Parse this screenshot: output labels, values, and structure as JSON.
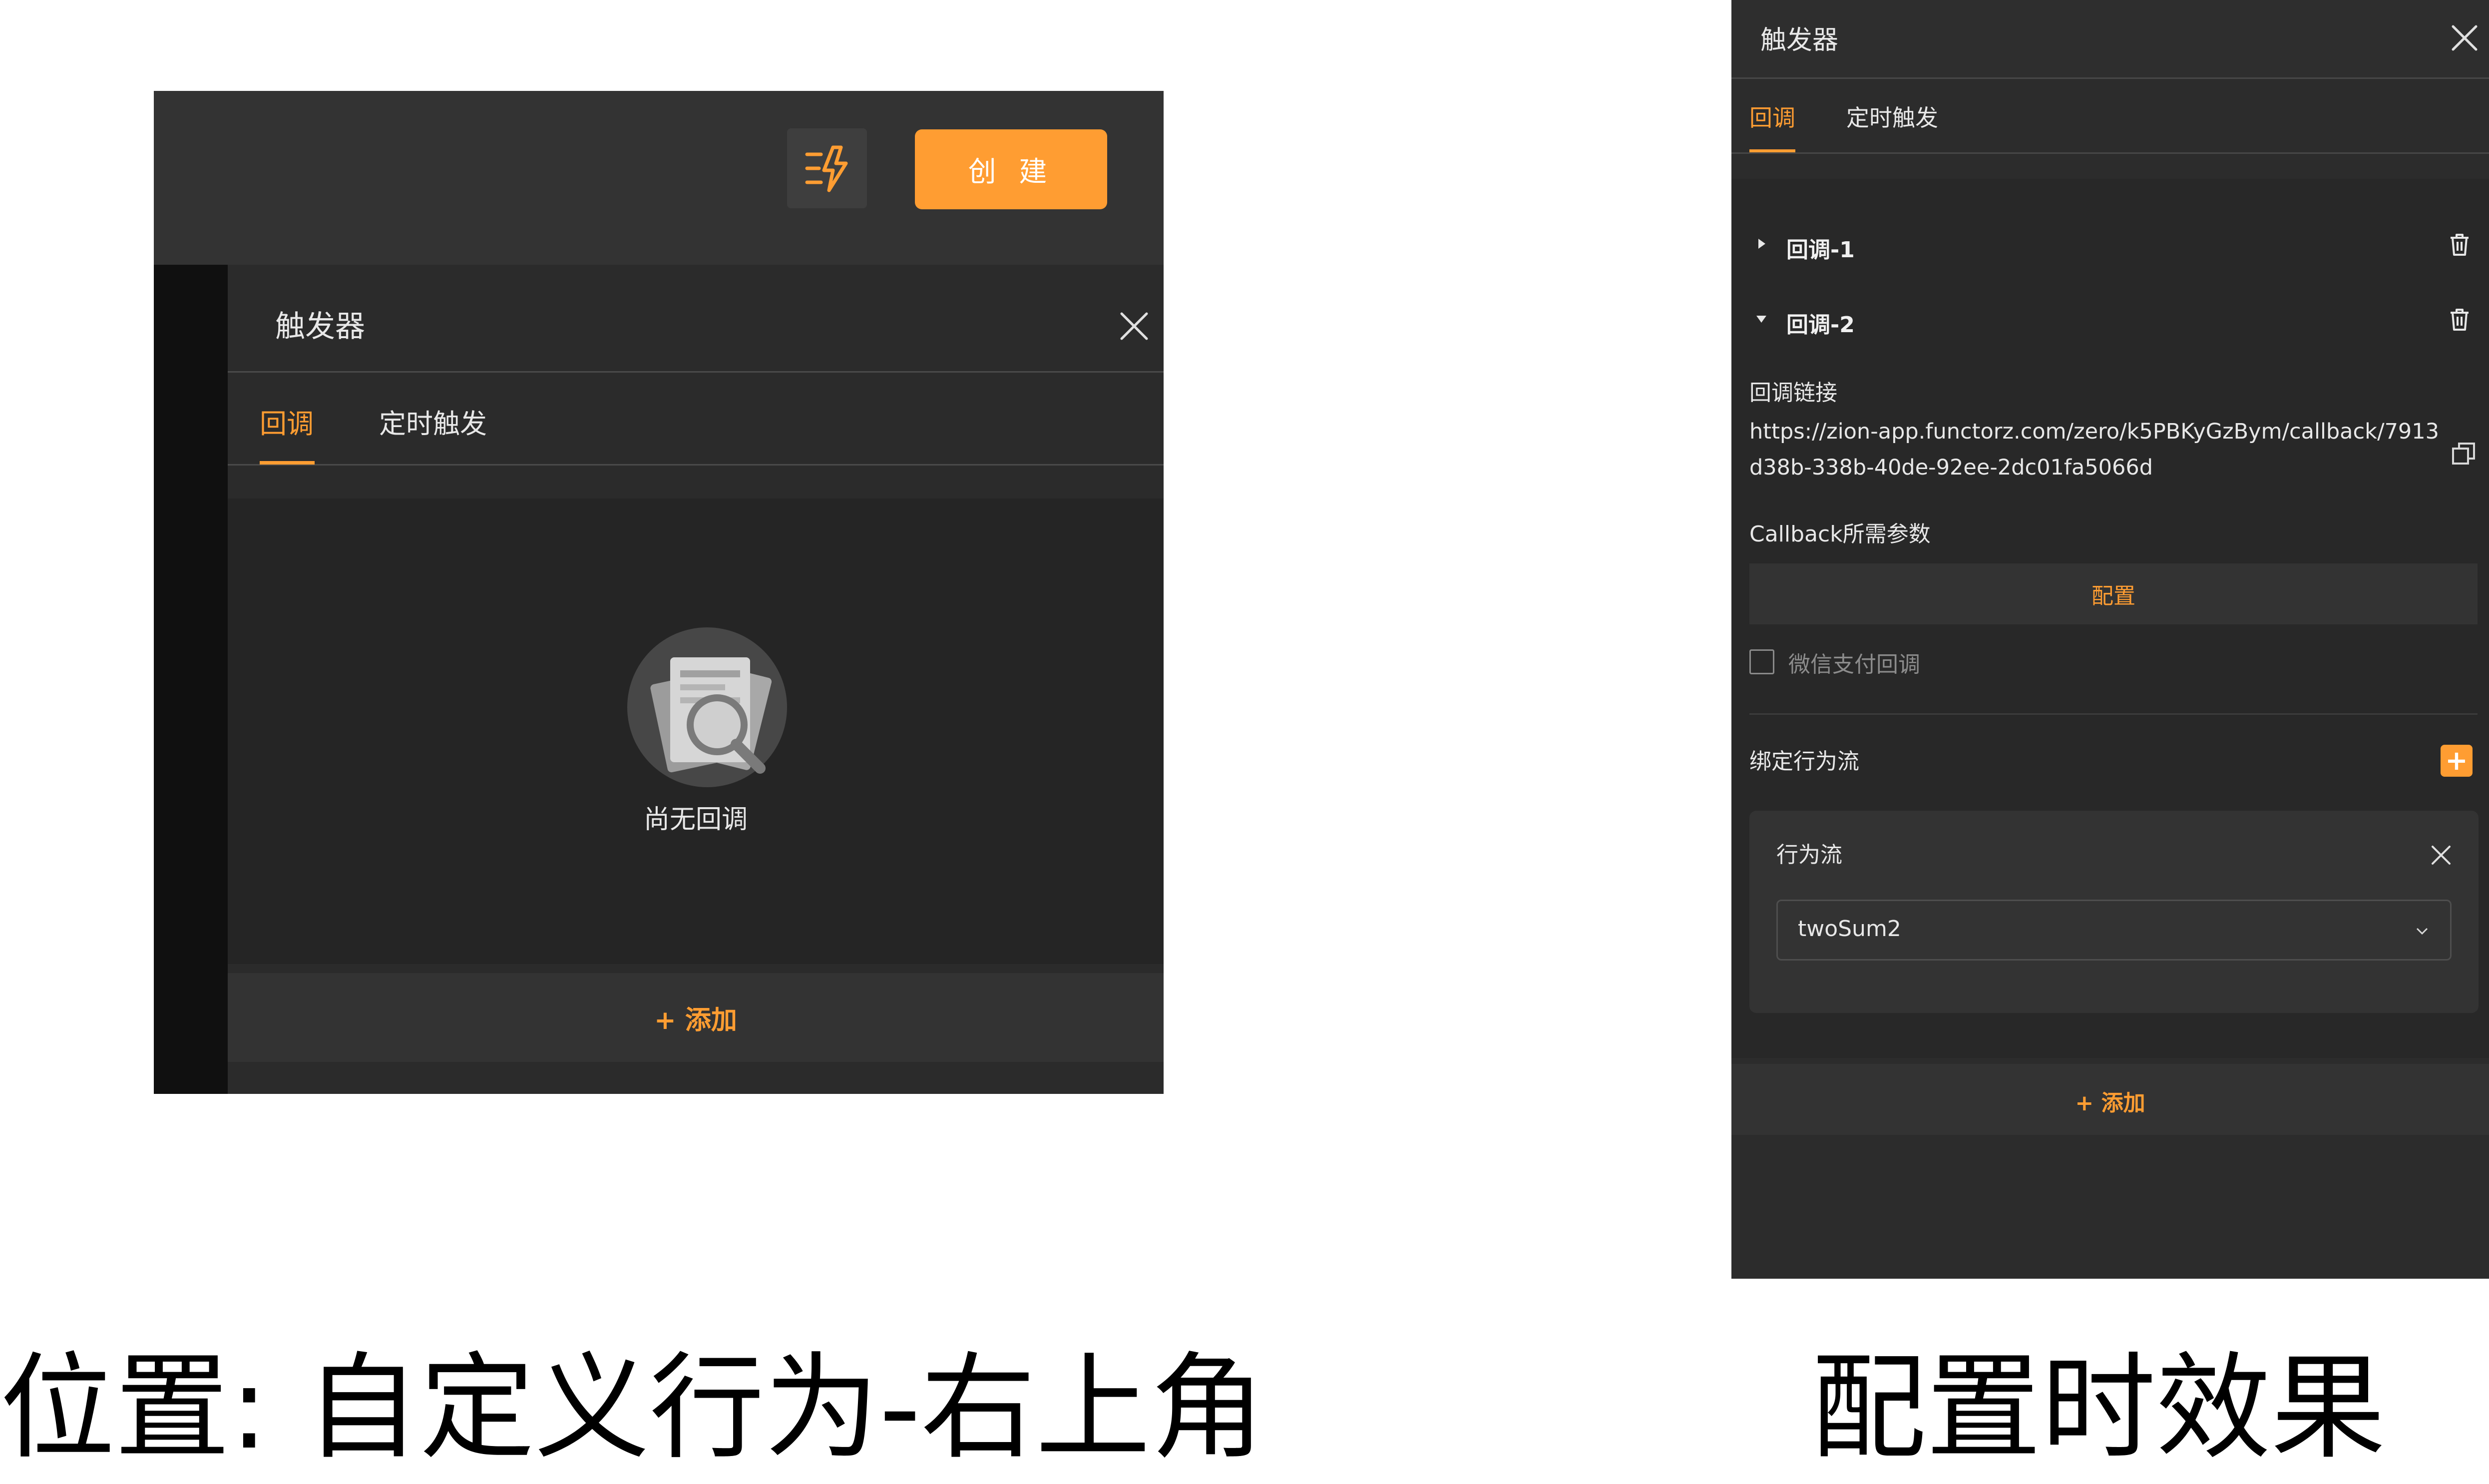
{
  "left": {
    "create_button": "创 建",
    "drawer": {
      "title": "触发器",
      "tabs": [
        {
          "label": "回调",
          "active": true
        },
        {
          "label": "定时触发",
          "active": false
        }
      ],
      "empty_text": "尚无回调",
      "add_label": "+ 添加"
    }
  },
  "right": {
    "title": "触发器",
    "tabs": [
      {
        "label": "回调",
        "active": true
      },
      {
        "label": "定时触发",
        "active": false
      }
    ],
    "callbacks": [
      {
        "name": "回调-1",
        "expanded": false
      },
      {
        "name": "回调-2",
        "expanded": true
      }
    ],
    "link_label": "回调链接",
    "link_url": "https://zion-app.functorz.com/zero/k5PBKyGzBym/callback/7913d38b-338b-40de-92ee-2dc01fa5066d",
    "params_label": "Callback所需参数",
    "config_button": "配置",
    "wechat_label": "微信支付回调",
    "wechat_checked": false,
    "bind_label": "绑定行为流",
    "bind_add": "+",
    "flow_card": {
      "title": "行为流",
      "selected": "twoSum2"
    },
    "add_label": "+ 添加"
  },
  "captions": {
    "left": "位置: 自定义行为-右上角",
    "right": "配置时效果"
  },
  "colors": {
    "accent": "#ff9d32",
    "panel": "#2c2c2c",
    "text": "#e8e8e8"
  }
}
